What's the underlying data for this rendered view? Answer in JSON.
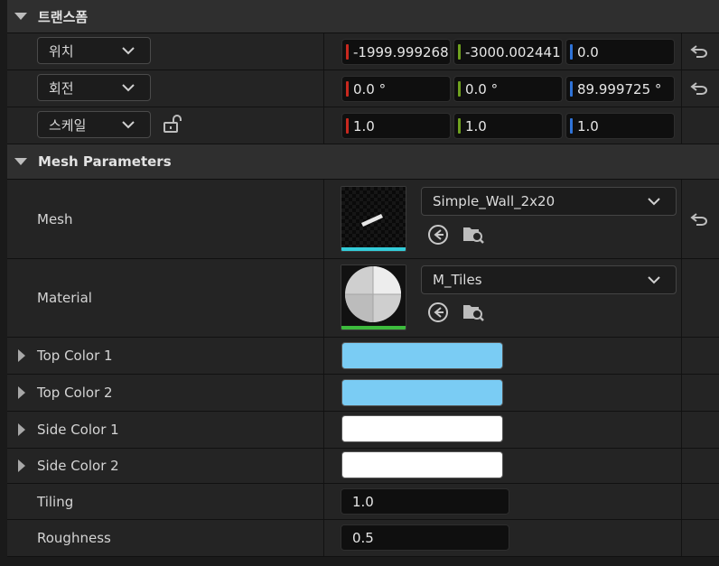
{
  "transform": {
    "title": "트랜스폼",
    "location": {
      "label": "위치",
      "x": "-1999.999268",
      "y": "-3000.002441",
      "z": "0.0"
    },
    "rotation": {
      "label": "회전",
      "x": "0.0 °",
      "y": "0.0 °",
      "z": "89.999725 °"
    },
    "scale": {
      "label": "스케일",
      "x": "1.0",
      "y": "1.0",
      "z": "1.0"
    }
  },
  "mesh_params": {
    "title": "Mesh Parameters",
    "mesh": {
      "label": "Mesh",
      "asset": "Simple_Wall_2x20"
    },
    "material": {
      "label": "Material",
      "asset": "M_Tiles"
    },
    "colors": [
      {
        "label": "Top Color 1",
        "color": "#7accf4"
      },
      {
        "label": "Top Color 2",
        "color": "#7accf4"
      },
      {
        "label": "Side Color 1",
        "color": "#ffffff"
      },
      {
        "label": "Side Color 2",
        "color": "#ffffff"
      }
    ],
    "tiling": {
      "label": "Tiling",
      "value": "1.0"
    },
    "roughness": {
      "label": "Roughness",
      "value": "0.5"
    }
  },
  "colors": {
    "x_axis": "#c8281e",
    "y_axis": "#6fa11f",
    "z_axis": "#2f73d8",
    "mesh_strip": "#33ccd9",
    "material_strip": "#3dbb3d"
  }
}
